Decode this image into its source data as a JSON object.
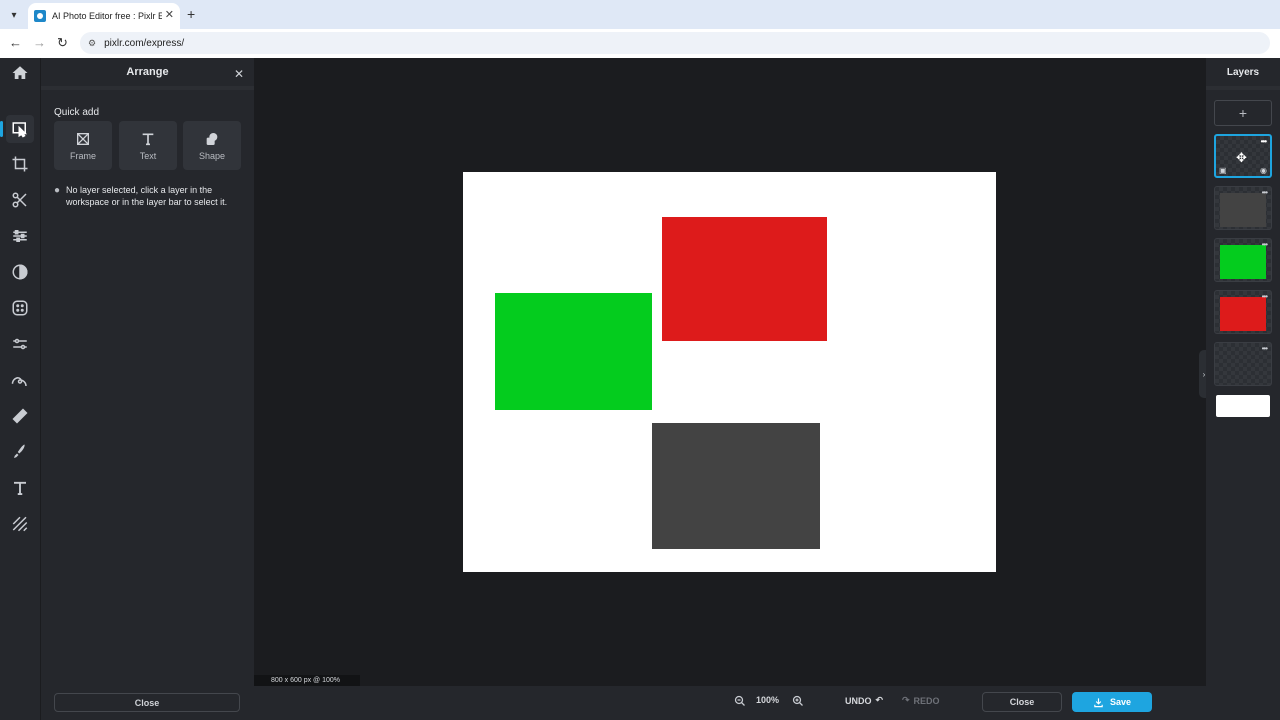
{
  "browser": {
    "tab_title": "AI Photo Editor free : Pixlr Expre",
    "url": "pixlr.com/express/"
  },
  "toolbar": {
    "tools": [
      "home-icon",
      "arrange-icon",
      "crop-icon",
      "cutout-icon",
      "adjust-icon",
      "filter-icon",
      "effect-icon",
      "liquify-icon",
      "retouch-icon",
      "heal-icon",
      "draw-icon",
      "text-icon",
      "pattern-icon"
    ],
    "active": "arrange-icon"
  },
  "panel": {
    "title": "Arrange",
    "quick_add_label": "Quick add",
    "quick_add": [
      {
        "label": "Frame",
        "icon": "frame-icon"
      },
      {
        "label": "Text",
        "icon": "text-icon"
      },
      {
        "label": "Shape",
        "icon": "shape-icon"
      }
    ],
    "hint": "No layer selected, click a layer in the workspace or in the layer bar to select it.",
    "close_label": "Close"
  },
  "canvas": {
    "background": "#ffffff",
    "shapes": [
      {
        "name": "red-rectangle",
        "color": "#dd1b1b"
      },
      {
        "name": "green-rectangle",
        "color": "#04cc1e"
      },
      {
        "name": "gray-rectangle",
        "color": "#434343"
      }
    ]
  },
  "status": "800 x 600 px @ 100%",
  "bottom": {
    "zoom": "100%",
    "undo_label": "UNDO",
    "redo_label": "REDO",
    "close_label": "Close",
    "save_label": "Save"
  },
  "layers": {
    "title": "Layers",
    "add_label": "+",
    "items": [
      {
        "name": "layer-transparent-selected",
        "fill": "transparent"
      },
      {
        "name": "layer-gray",
        "fill": "#434343"
      },
      {
        "name": "layer-green",
        "fill": "#04cc1e"
      },
      {
        "name": "layer-red",
        "fill": "#dd1b1b"
      },
      {
        "name": "layer-transparent",
        "fill": "transparent"
      },
      {
        "name": "layer-background",
        "fill": "#ffffff"
      }
    ]
  },
  "colors": {
    "accent": "#1ea5e0",
    "panel": "#25272c",
    "workspace": "#1b1c1f"
  }
}
